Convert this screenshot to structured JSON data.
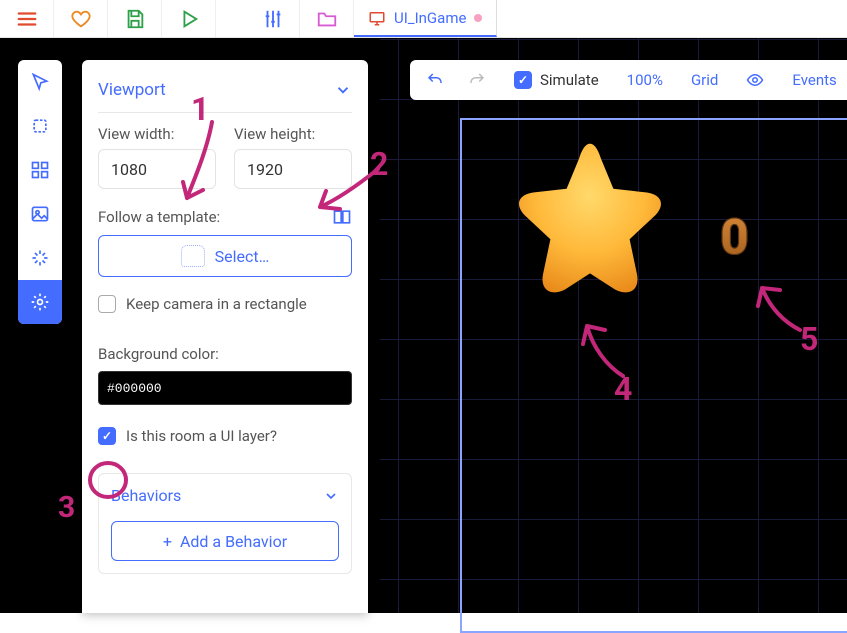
{
  "tab": {
    "title": "UI_InGame"
  },
  "panel": {
    "viewport_title": "Viewport",
    "view_width_label": "View width:",
    "view_height_label": "View height:",
    "view_width": "1080",
    "view_height": "1920",
    "follow_template_label": "Follow a template:",
    "select_label": "Select…",
    "keep_camera_label": "Keep camera in a rectangle",
    "bg_label": "Background color:",
    "bg_value": "#000000",
    "is_ui_label": "Is this room a UI layer?",
    "behaviors_title": "Behaviors",
    "add_behavior_label": "Add a Behavior"
  },
  "canvas_toolbar": {
    "simulate_label": "Simulate",
    "zoom_label": "100%",
    "grid_label": "Grid",
    "events_label": "Events"
  },
  "scene": {
    "score_text": "0"
  },
  "annotations": {
    "n1": "1",
    "n2": "2",
    "n3": "3",
    "n4": "4",
    "n5": "5"
  }
}
